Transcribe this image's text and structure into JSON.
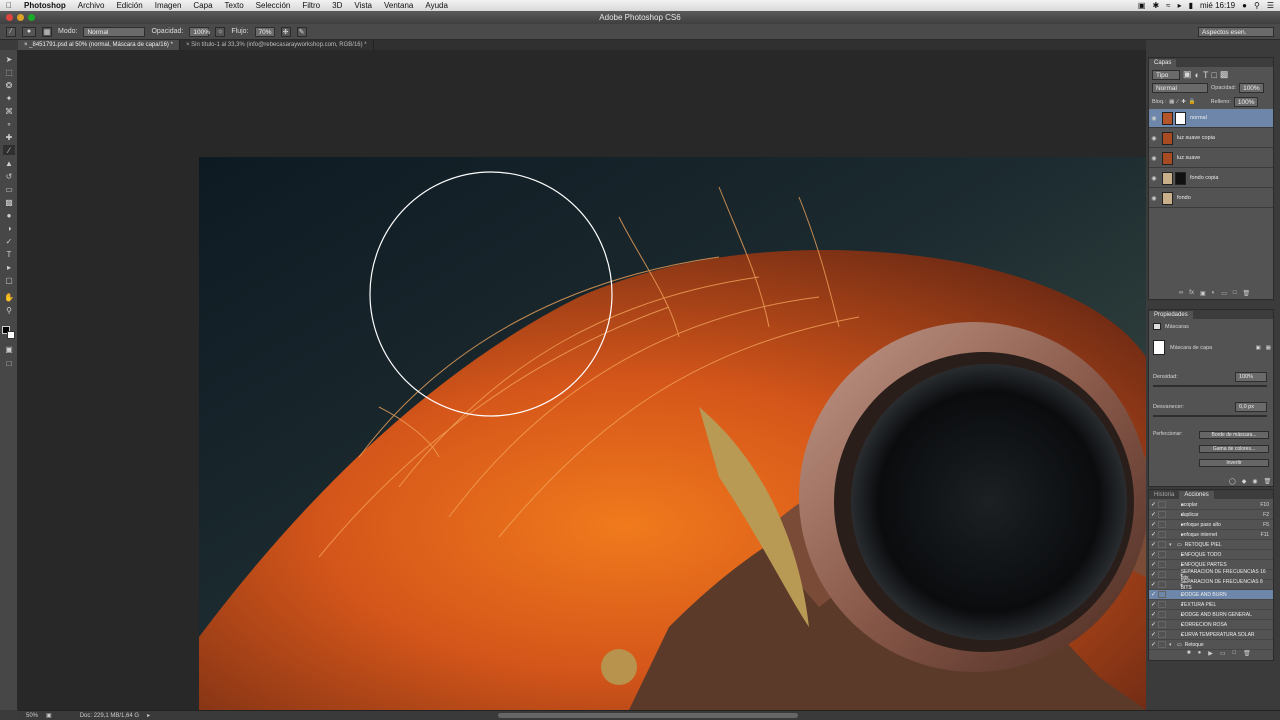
{
  "menubar": {
    "app": "Photoshop",
    "items": [
      "Archivo",
      "Edición",
      "Imagen",
      "Capa",
      "Texto",
      "Selección",
      "Filtro",
      "3D",
      "Vista",
      "Ventana",
      "Ayuda"
    ],
    "clock": "mié 16:19"
  },
  "window": {
    "title": "Adobe Photoshop CS6"
  },
  "options": {
    "mode_label": "Modo:",
    "mode_value": "Normal",
    "opacity_label": "Opacidad:",
    "opacity_value": "100%",
    "flow_label": "Flujo:",
    "flow_value": "70%",
    "workspace_value": "Aspectos esen."
  },
  "tabs": [
    {
      "label": "_8451791.psd al 50% (normal, Máscara de capa/16) *"
    },
    {
      "label": "Sin título-1 al 33,3% (info@rebecasarayworkshop.com, RGB/16) *"
    }
  ],
  "status": {
    "zoom": "50%",
    "doc": "Doc: 229,1 MB/1,64 G"
  },
  "layers_panel": {
    "tab": "Capas",
    "kind_value": "Tipo",
    "blend_value": "Normal",
    "opacity_label": "Opacidad:",
    "opacity_value": "100%",
    "lock_label": "Bloq.:",
    "fill_label": "Relleno:",
    "fill_value": "100%",
    "layers": [
      {
        "name": "normal"
      },
      {
        "name": "luz suave copia"
      },
      {
        "name": "luz suave"
      },
      {
        "name": "fondo copia"
      },
      {
        "name": "fondo"
      }
    ]
  },
  "properties_panel": {
    "tab": "Propiedades",
    "section": "Máscaras",
    "mask_label": "Máscara de capa",
    "density_label": "Densidad:",
    "density_value": "100%",
    "feather_label": "Desvanecer:",
    "feather_value": "0,0 px",
    "refine_label": "Perfeccionar:",
    "btn_edge": "Borde de máscara...",
    "btn_color": "Gama de colores...",
    "btn_invert": "Invertir"
  },
  "actions_panel": {
    "tabs": [
      "Historia",
      "Acciones"
    ],
    "items": [
      {
        "label": "acoplar",
        "key": "F10"
      },
      {
        "label": "duplicar",
        "key": "F2"
      },
      {
        "label": "enfoque paso alto",
        "key": "F5"
      },
      {
        "label": "enfoque internet",
        "key": "F11"
      },
      {
        "label": "RETOQUE PIEL",
        "key": ""
      },
      {
        "label": "ENFOQUE TODO",
        "key": ""
      },
      {
        "label": "ENFOQUE PARTES",
        "key": ""
      },
      {
        "label": "SEPARACION DE FRECUENCIAS 16 bits",
        "key": ""
      },
      {
        "label": "SEPARACION DE FRECUENCIAS 8 BITS",
        "key": ""
      },
      {
        "label": "DODGE AND BURN",
        "key": ""
      },
      {
        "label": "TEXTURA PIEL",
        "key": ""
      },
      {
        "label": "DODGE AND BURN GENERAL",
        "key": ""
      },
      {
        "label": "CORRECION ROSA",
        "key": ""
      },
      {
        "label": "CURVA TEMPERATURA SOLAR",
        "key": ""
      },
      {
        "label": "Retoque",
        "key": ""
      }
    ]
  },
  "colors": {
    "accent": "#6d86a9",
    "panel": "#535353",
    "pasteboard": "#282828"
  }
}
